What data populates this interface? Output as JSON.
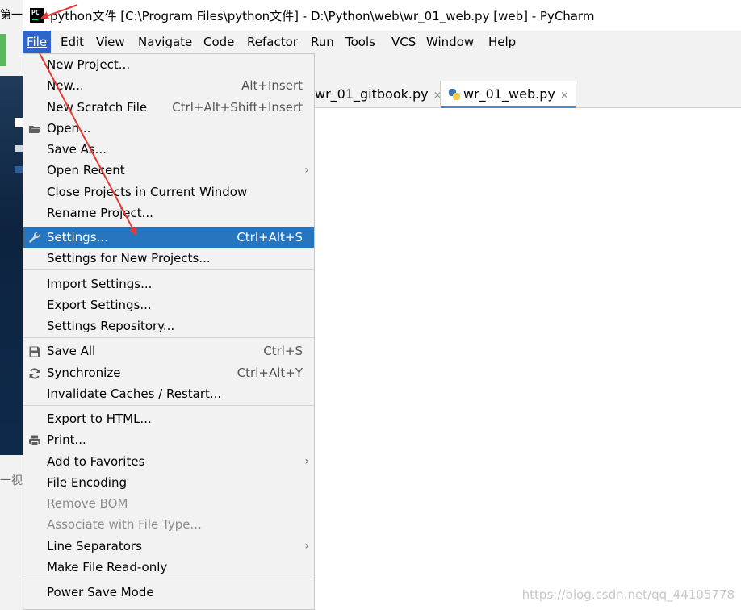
{
  "background": {
    "top_text": "第一",
    "bottom_text": "一视"
  },
  "window": {
    "title": "python文件 [C:\\Program Files\\python文件] - D:\\Python\\web\\wr_01_web.py [web] - PyCharm",
    "app_icon": "pycharm-logo",
    "logo_text": "PC"
  },
  "menubar": {
    "items": [
      "File",
      "Edit",
      "View",
      "Navigate",
      "Code",
      "Refactor",
      "Run",
      "Tools",
      "VCS",
      "Window",
      "Help"
    ]
  },
  "tabs": [
    {
      "label": "wr_01_gitbook.py",
      "close": "×"
    },
    {
      "label": "wr_01_web.py",
      "close": "×",
      "active": true
    }
  ],
  "file_menu": {
    "items": [
      {
        "label": "New Project...",
        "shortcut": ""
      },
      {
        "label": "New...",
        "shortcut": "Alt+Insert"
      },
      {
        "label": "New Scratch File",
        "shortcut": "Ctrl+Alt+Shift+Insert"
      },
      {
        "label": "Open...",
        "shortcut": "",
        "icon": "folder-icon"
      },
      {
        "label": "Save As...",
        "shortcut": ""
      },
      {
        "label": "Open Recent",
        "shortcut": "",
        "submenu": true
      },
      {
        "label": "Close Projects in Current Window",
        "shortcut": ""
      },
      {
        "label": "Rename Project...",
        "shortcut": ""
      },
      {
        "label": "Settings...",
        "shortcut": "Ctrl+Alt+S",
        "icon": "wrench-icon",
        "selected": true
      },
      {
        "label": "Settings for New Projects...",
        "shortcut": ""
      },
      {
        "label": "Import Settings...",
        "shortcut": ""
      },
      {
        "label": "Export Settings...",
        "shortcut": ""
      },
      {
        "label": "Settings Repository...",
        "shortcut": ""
      },
      {
        "label": "Save All",
        "shortcut": "Ctrl+S",
        "icon": "save-icon"
      },
      {
        "label": "Synchronize",
        "shortcut": "Ctrl+Alt+Y",
        "icon": "sync-icon"
      },
      {
        "label": "Invalidate Caches / Restart...",
        "shortcut": ""
      },
      {
        "label": "Export to HTML...",
        "shortcut": ""
      },
      {
        "label": "Print...",
        "shortcut": "",
        "icon": "printer-icon"
      },
      {
        "label": "Add to Favorites",
        "shortcut": "",
        "submenu": true
      },
      {
        "label": "File Encoding",
        "shortcut": ""
      },
      {
        "label": "Remove BOM",
        "shortcut": "",
        "disabled": true
      },
      {
        "label": "Associate with File Type...",
        "shortcut": "",
        "disabled": true
      },
      {
        "label": "Line Separators",
        "shortcut": "",
        "submenu": true
      },
      {
        "label": "Make File Read-only",
        "shortcut": ""
      },
      {
        "label": "Power Save Mode",
        "shortcut": ""
      }
    ],
    "submenu_arrow": "›"
  },
  "watermark": "https://blog.csdn.net/qq_44105778",
  "colors": {
    "selected_bg": "#2675bf",
    "active_menu_bg": "#2f65ca",
    "annotation_arrow": "#e53935"
  }
}
